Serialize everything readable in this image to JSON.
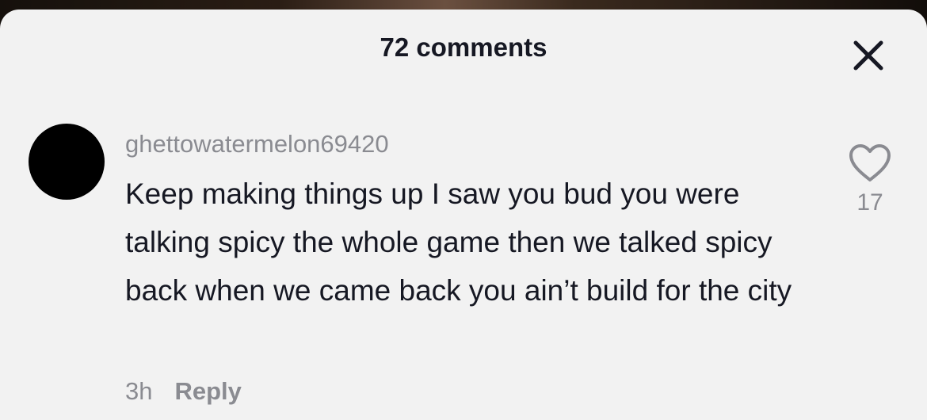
{
  "header": {
    "title": "72 comments",
    "close_icon": "close-icon"
  },
  "comment": {
    "avatar_color": "#000000",
    "username": "ghettowatermelon69420",
    "text": "Keep making things up I saw you bud you were talking spicy the whole game then we talked spicy back when we came back you ain’t build for the city",
    "timestamp": "3h",
    "reply_label": "Reply",
    "like_icon": "heart-outline-icon",
    "like_count": "17"
  },
  "colors": {
    "sheet_background": "#f2f2f2",
    "primary_text": "#161823",
    "secondary_text": "#8a8b91"
  }
}
